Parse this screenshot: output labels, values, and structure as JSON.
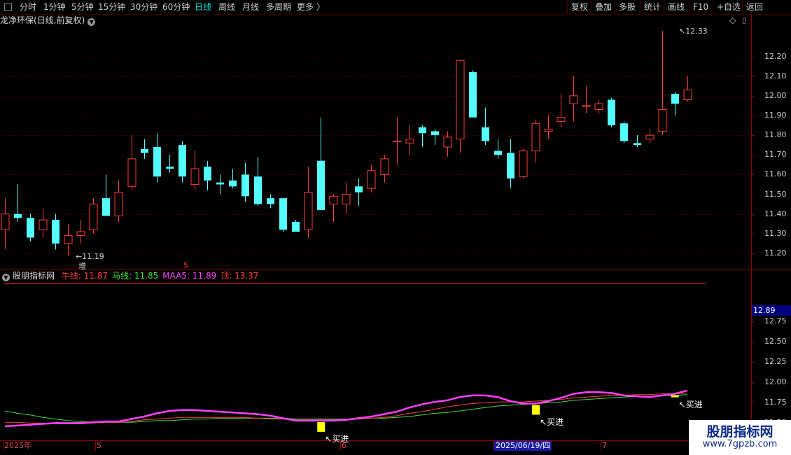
{
  "toolbar": {
    "left_items": [
      "分时",
      "1分钟",
      "5分钟",
      "15分钟",
      "30分钟",
      "60分钟",
      "日线",
      "周线",
      "月线",
      "多周期",
      "更多 〉"
    ],
    "active": "日线",
    "right_items": [
      "复权",
      "叠加",
      "多股",
      "统计",
      "画线",
      "F10",
      "+自选",
      "返回"
    ]
  },
  "main_chart": {
    "title": "龙净环保(日线,前复权)",
    "high_label": "12.33",
    "low_label": "11.19",
    "badge_zeng": "增",
    "badge_other": "$",
    "y_ticks": [
      "12.20",
      "12.10",
      "12.00",
      "11.90",
      "11.80",
      "11.70",
      "11.60",
      "11.50",
      "11.40",
      "11.30",
      "11.20"
    ]
  },
  "indicator": {
    "name": "股朋指标网",
    "items": [
      {
        "label": "牛线:",
        "value": "11.87",
        "color": "#ff4040"
      },
      {
        "label": "马线:",
        "value": "11.85",
        "color": "#40e040"
      },
      {
        "label": "MAA5:",
        "value": "11.89",
        "color": "#ff40ff"
      },
      {
        "label": "顶:",
        "value": "13.37",
        "color": "#ff4040"
      }
    ],
    "current_value": "12.89",
    "y_ticks": [
      "12.75",
      "12.50",
      "12.25",
      "12.00",
      "11.75",
      "11.50"
    ],
    "signal_label": "买进"
  },
  "date_axis": {
    "labels": [
      {
        "text": "2025年"
      },
      {
        "text": "5"
      },
      {
        "text": "6"
      },
      {
        "text": "2025/06/19/四"
      },
      {
        "text": "7"
      }
    ]
  },
  "watermark": {
    "line1": "股朋指标网",
    "line2": "www.7gpzb.com"
  },
  "colors": {
    "up": "#ff3c3c",
    "down": "#54ffff",
    "bull": "#ff4040",
    "horse": "#40e040",
    "maa5": "#ff40ff",
    "signal": "#ffff00"
  },
  "chart_data": {
    "type": "candlestick",
    "y_range": [
      11.15,
      12.33
    ],
    "candles": [
      {
        "o": 11.32,
        "h": 11.48,
        "l": 11.22,
        "c": 11.4
      },
      {
        "o": 11.4,
        "h": 11.55,
        "l": 11.36,
        "c": 11.38
      },
      {
        "o": 11.38,
        "h": 11.4,
        "l": 11.26,
        "c": 11.28
      },
      {
        "o": 11.32,
        "h": 11.43,
        "l": 11.28,
        "c": 11.37
      },
      {
        "o": 11.37,
        "h": 11.4,
        "l": 11.22,
        "c": 11.25
      },
      {
        "o": 11.25,
        "h": 11.35,
        "l": 11.19,
        "c": 11.29
      },
      {
        "o": 11.29,
        "h": 11.37,
        "l": 11.25,
        "c": 11.31
      },
      {
        "o": 11.32,
        "h": 11.48,
        "l": 11.3,
        "c": 11.45
      },
      {
        "o": 11.48,
        "h": 11.6,
        "l": 11.39,
        "c": 11.39
      },
      {
        "o": 11.39,
        "h": 11.57,
        "l": 11.36,
        "c": 11.51
      },
      {
        "o": 11.54,
        "h": 11.8,
        "l": 11.52,
        "c": 11.68
      },
      {
        "o": 11.73,
        "h": 11.78,
        "l": 11.68,
        "c": 11.71
      },
      {
        "o": 11.74,
        "h": 11.81,
        "l": 11.56,
        "c": 11.59
      },
      {
        "o": 11.64,
        "h": 11.7,
        "l": 11.61,
        "c": 11.63
      },
      {
        "o": 11.75,
        "h": 11.77,
        "l": 11.56,
        "c": 11.59
      },
      {
        "o": 11.55,
        "h": 11.72,
        "l": 11.52,
        "c": 11.63
      },
      {
        "o": 11.64,
        "h": 11.67,
        "l": 11.52,
        "c": 11.57
      },
      {
        "o": 11.56,
        "h": 11.6,
        "l": 11.5,
        "c": 11.55
      },
      {
        "o": 11.57,
        "h": 11.63,
        "l": 11.53,
        "c": 11.54
      },
      {
        "o": 11.6,
        "h": 11.66,
        "l": 11.46,
        "c": 11.49
      },
      {
        "o": 11.59,
        "h": 11.69,
        "l": 11.44,
        "c": 11.45
      },
      {
        "o": 11.48,
        "h": 11.5,
        "l": 11.43,
        "c": 11.45
      },
      {
        "o": 11.48,
        "h": 11.48,
        "l": 11.31,
        "c": 11.32
      },
      {
        "o": 11.36,
        "h": 11.37,
        "l": 11.31,
        "c": 11.31
      },
      {
        "o": 11.32,
        "h": 11.64,
        "l": 11.28,
        "c": 11.51
      },
      {
        "o": 11.67,
        "h": 11.89,
        "l": 11.44,
        "c": 11.42
      },
      {
        "o": 11.45,
        "h": 11.5,
        "l": 11.36,
        "c": 11.49
      },
      {
        "o": 11.45,
        "h": 11.56,
        "l": 11.4,
        "c": 11.5
      },
      {
        "o": 11.54,
        "h": 11.58,
        "l": 11.44,
        "c": 11.51
      },
      {
        "o": 11.53,
        "h": 11.65,
        "l": 11.51,
        "c": 11.62
      },
      {
        "o": 11.6,
        "h": 11.7,
        "l": 11.56,
        "c": 11.68
      },
      {
        "o": 11.77,
        "h": 11.89,
        "l": 11.65,
        "c": 11.77
      },
      {
        "o": 11.76,
        "h": 11.85,
        "l": 11.7,
        "c": 11.78
      },
      {
        "o": 11.84,
        "h": 11.85,
        "l": 11.74,
        "c": 11.81
      },
      {
        "o": 11.82,
        "h": 11.83,
        "l": 11.75,
        "c": 11.8
      },
      {
        "o": 11.74,
        "h": 11.82,
        "l": 11.69,
        "c": 11.79
      },
      {
        "o": 11.78,
        "h": 12.16,
        "l": 11.71,
        "c": 12.18
      },
      {
        "o": 12.12,
        "h": 12.13,
        "l": 11.92,
        "c": 11.89
      },
      {
        "o": 11.84,
        "h": 11.94,
        "l": 11.75,
        "c": 11.77
      },
      {
        "o": 11.72,
        "h": 11.78,
        "l": 11.68,
        "c": 11.7
      },
      {
        "o": 11.71,
        "h": 11.78,
        "l": 11.53,
        "c": 11.58
      },
      {
        "o": 11.59,
        "h": 11.73,
        "l": 11.58,
        "c": 11.72
      },
      {
        "o": 11.72,
        "h": 11.88,
        "l": 11.66,
        "c": 11.86
      },
      {
        "o": 11.82,
        "h": 11.9,
        "l": 11.78,
        "c": 11.83
      },
      {
        "o": 11.87,
        "h": 12.01,
        "l": 11.84,
        "c": 11.89
      },
      {
        "o": 11.96,
        "h": 12.1,
        "l": 11.87,
        "c": 12.0
      },
      {
        "o": 11.95,
        "h": 12.05,
        "l": 11.91,
        "c": 11.95
      },
      {
        "o": 11.93,
        "h": 11.98,
        "l": 11.91,
        "c": 11.96
      },
      {
        "o": 11.98,
        "h": 11.99,
        "l": 11.84,
        "c": 11.85
      },
      {
        "o": 11.86,
        "h": 11.87,
        "l": 11.76,
        "c": 11.77
      },
      {
        "o": 11.76,
        "h": 11.8,
        "l": 11.74,
        "c": 11.75
      },
      {
        "o": 11.78,
        "h": 11.83,
        "l": 11.76,
        "c": 11.8
      },
      {
        "o": 11.82,
        "h": 12.33,
        "l": 11.8,
        "c": 11.93
      },
      {
        "o": 12.01,
        "h": 12.02,
        "l": 11.9,
        "c": 11.96
      },
      {
        "o": 11.98,
        "h": 12.1,
        "l": 11.97,
        "c": 12.03
      }
    ],
    "indicator_range": [
      11.4,
      12.95
    ],
    "maa5": [
      11.46,
      11.47,
      11.48,
      11.49,
      11.5,
      11.5,
      11.5,
      11.51,
      11.52,
      11.52,
      11.55,
      11.58,
      11.62,
      11.65,
      11.66,
      11.66,
      11.65,
      11.64,
      11.63,
      11.62,
      11.61,
      11.59,
      11.56,
      11.53,
      11.53,
      11.53,
      11.53,
      11.54,
      11.56,
      11.58,
      11.61,
      11.64,
      11.69,
      11.73,
      11.76,
      11.78,
      11.82,
      11.84,
      11.84,
      11.82,
      11.77,
      11.74,
      11.74,
      11.77,
      11.81,
      11.86,
      11.88,
      11.88,
      11.87,
      11.84,
      11.83,
      11.82,
      11.84,
      11.86,
      11.9
    ],
    "bull": [
      11.51,
      11.51,
      11.5,
      11.5,
      11.49,
      11.49,
      11.49,
      11.5,
      11.51,
      11.51,
      11.52,
      11.54,
      11.55,
      11.56,
      11.57,
      11.57,
      11.57,
      11.57,
      11.57,
      11.57,
      11.56,
      11.55,
      11.55,
      11.54,
      11.54,
      11.54,
      11.54,
      11.54,
      11.55,
      11.56,
      11.57,
      11.59,
      11.62,
      11.64,
      11.67,
      11.7,
      11.72,
      11.74,
      11.75,
      11.76,
      11.76,
      11.76,
      11.77,
      11.78,
      11.79,
      11.81,
      11.82,
      11.83,
      11.84,
      11.84,
      11.85,
      11.85,
      11.86,
      11.86,
      11.87
    ],
    "horse": [
      11.65,
      11.62,
      11.6,
      11.57,
      11.55,
      11.53,
      11.52,
      11.51,
      11.51,
      11.51,
      11.51,
      11.52,
      11.53,
      11.53,
      11.54,
      11.55,
      11.55,
      11.56,
      11.56,
      11.56,
      11.56,
      11.56,
      11.56,
      11.55,
      11.55,
      11.55,
      11.55,
      11.55,
      11.55,
      11.56,
      11.56,
      11.57,
      11.58,
      11.6,
      11.62,
      11.63,
      11.65,
      11.67,
      11.69,
      11.71,
      11.72,
      11.73,
      11.74,
      11.75,
      11.76,
      11.78,
      11.79,
      11.8,
      11.81,
      11.82,
      11.83,
      11.83,
      11.84,
      11.84,
      11.85
    ],
    "signals": [
      25,
      42,
      53
    ]
  }
}
